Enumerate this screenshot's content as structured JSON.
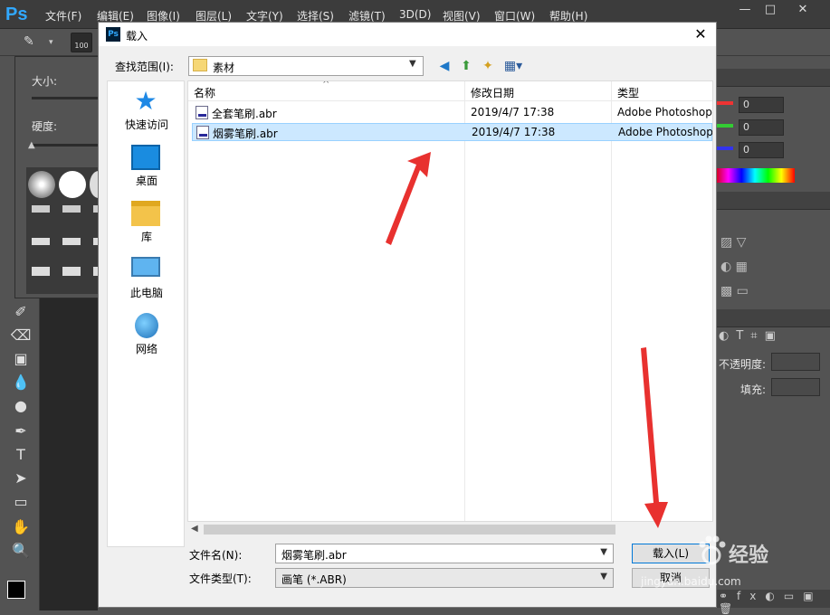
{
  "app": {
    "logo": "Ps",
    "menu": [
      "文件(F)",
      "编辑(E)",
      "图像(I)",
      "图层(L)",
      "文字(Y)",
      "选择(S)",
      "滤镜(T)",
      "3D(D)",
      "视图(V)",
      "窗口(W)",
      "帮助(H)"
    ],
    "window_controls": [
      "—",
      "□",
      "✕"
    ]
  },
  "options_bar": {
    "brush_size": "100"
  },
  "brush_panel": {
    "size_label": "大小:",
    "hardness_label": "硬度:"
  },
  "right_panel": {
    "color_values": [
      "0",
      "0",
      "0"
    ],
    "opacity_label": "不透明度:",
    "fill_label": "填充:"
  },
  "dialog": {
    "title": "载入",
    "icon": "Ps",
    "close": "✕",
    "lookin_label": "查找范围(I):",
    "lookin_value": "素材",
    "places": [
      {
        "label": "快速访问",
        "icon": "star-icon"
      },
      {
        "label": "桌面",
        "icon": "desktop-icon"
      },
      {
        "label": "库",
        "icon": "library-icon"
      },
      {
        "label": "此电脑",
        "icon": "computer-icon"
      },
      {
        "label": "网络",
        "icon": "network-icon"
      }
    ],
    "columns": [
      "名称",
      "修改日期",
      "类型"
    ],
    "files": [
      {
        "name": "全套笔刷.abr",
        "date": "2019/4/7 17:38",
        "type": "Adobe Photoshop",
        "selected": false
      },
      {
        "name": "烟雾笔刷.abr",
        "date": "2019/4/7 17:38",
        "type": "Adobe Photoshop",
        "selected": true
      }
    ],
    "filename_label": "文件名(N):",
    "filename_value": "烟雾笔刷.abr",
    "filetype_label": "文件类型(T):",
    "filetype_value": "画笔 (*.ABR)",
    "load_button": "载入(L)",
    "cancel_button": "取消"
  },
  "watermark": {
    "main": "经验",
    "sub": "jingyan.baidu.com"
  },
  "colors": {
    "ps_blue": "#31a8ff",
    "selection": "#cce8ff",
    "arrow": "#e8312f"
  }
}
